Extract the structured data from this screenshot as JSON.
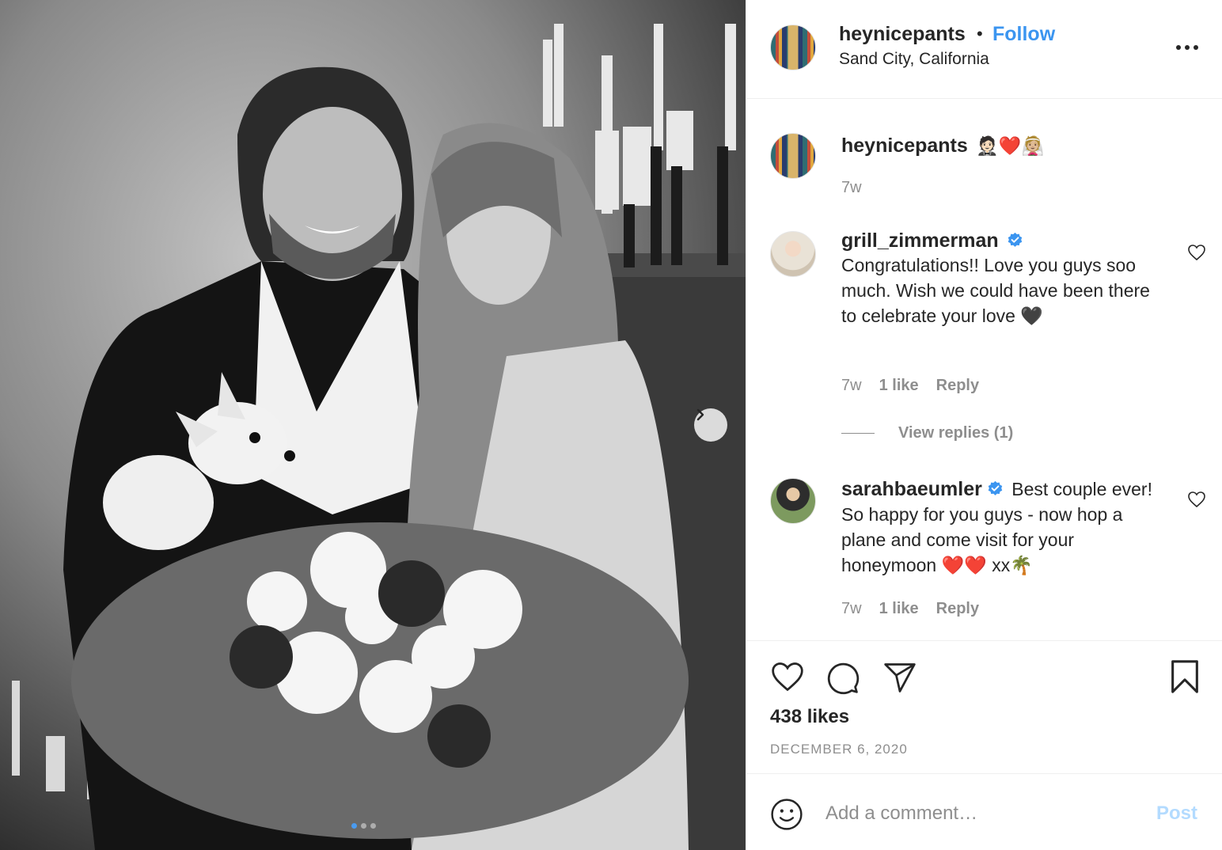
{
  "post": {
    "photo_alt": "Black and white photo of a couple with a chihuahua and a bouquet",
    "carousel": {
      "slides": 3,
      "active": 1
    }
  },
  "header": {
    "username": "heynicepants",
    "separator": "•",
    "follow_label": "Follow",
    "location": "Sand City, California"
  },
  "caption": {
    "username": "heynicepants",
    "text": "🤵🏻❤️👰🏼",
    "time": "7w"
  },
  "comments": [
    {
      "username": "grill_zimmerman",
      "verified": true,
      "text": "Congratulations!! Love you guys soo much. Wish we could have been there to celebrate your love 🖤",
      "time": "7w",
      "likes": "1 like",
      "reply_label": "Reply",
      "view_replies": "View replies (1)"
    },
    {
      "username": "sarahbaeumler",
      "verified": true,
      "text": "Best couple ever! So happy for you guys - now hop a plane and come visit for your honeymoon ❤️❤️ xx🌴",
      "time": "7w",
      "likes": "1 like",
      "reply_label": "Reply"
    }
  ],
  "stats": {
    "likes": "438 likes",
    "date": "DECEMBER 6, 2020"
  },
  "add_comment": {
    "placeholder": "Add a comment…",
    "post_label": "Post"
  },
  "colors": {
    "accent": "#3b95f0",
    "text": "#262626",
    "muted": "#8e8e8e",
    "post_disabled": "#b3dbff",
    "border": "#efefef"
  },
  "icons": [
    "chevron-right-icon",
    "more-icon",
    "heart-icon",
    "comment-icon",
    "share-icon",
    "bookmark-icon",
    "emoji-icon",
    "verified-badge-icon"
  ]
}
